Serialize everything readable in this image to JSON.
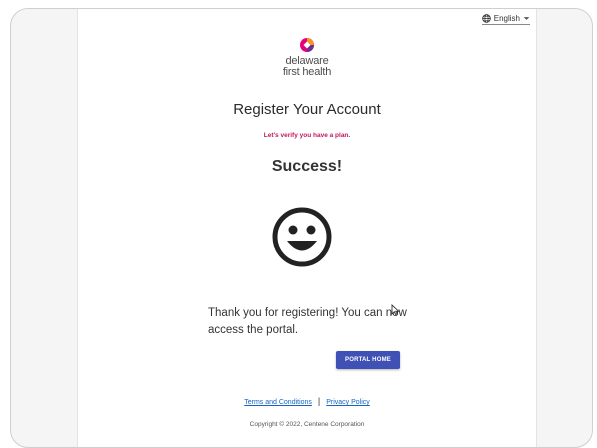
{
  "language": {
    "selected": "English",
    "icon": "globe-icon",
    "dropdown_icon": "caret-down-icon"
  },
  "brand": {
    "line1": "delaware",
    "line2": "first health",
    "colors": {
      "orange": "#f7941d",
      "pink": "#e6007e",
      "purple": "#6d2c91"
    }
  },
  "header": {
    "title": "Register Your Account",
    "subtitle": "Let's verify you have a plan."
  },
  "result": {
    "heading": "Success!",
    "icon": "smiley-face-icon",
    "message": "Thank you for registering! You can now access the portal."
  },
  "actions": {
    "portal_home_label": "PORTAL HOME"
  },
  "footer": {
    "terms_label": "Terms and Conditions",
    "separator": "|",
    "privacy_label": "Privacy Policy",
    "copyright": "Copyright © 2022, Centene Corporation"
  },
  "colors": {
    "primary_button": "#3f51b5",
    "subtitle": "#c2185b",
    "link": "#1565c0"
  }
}
